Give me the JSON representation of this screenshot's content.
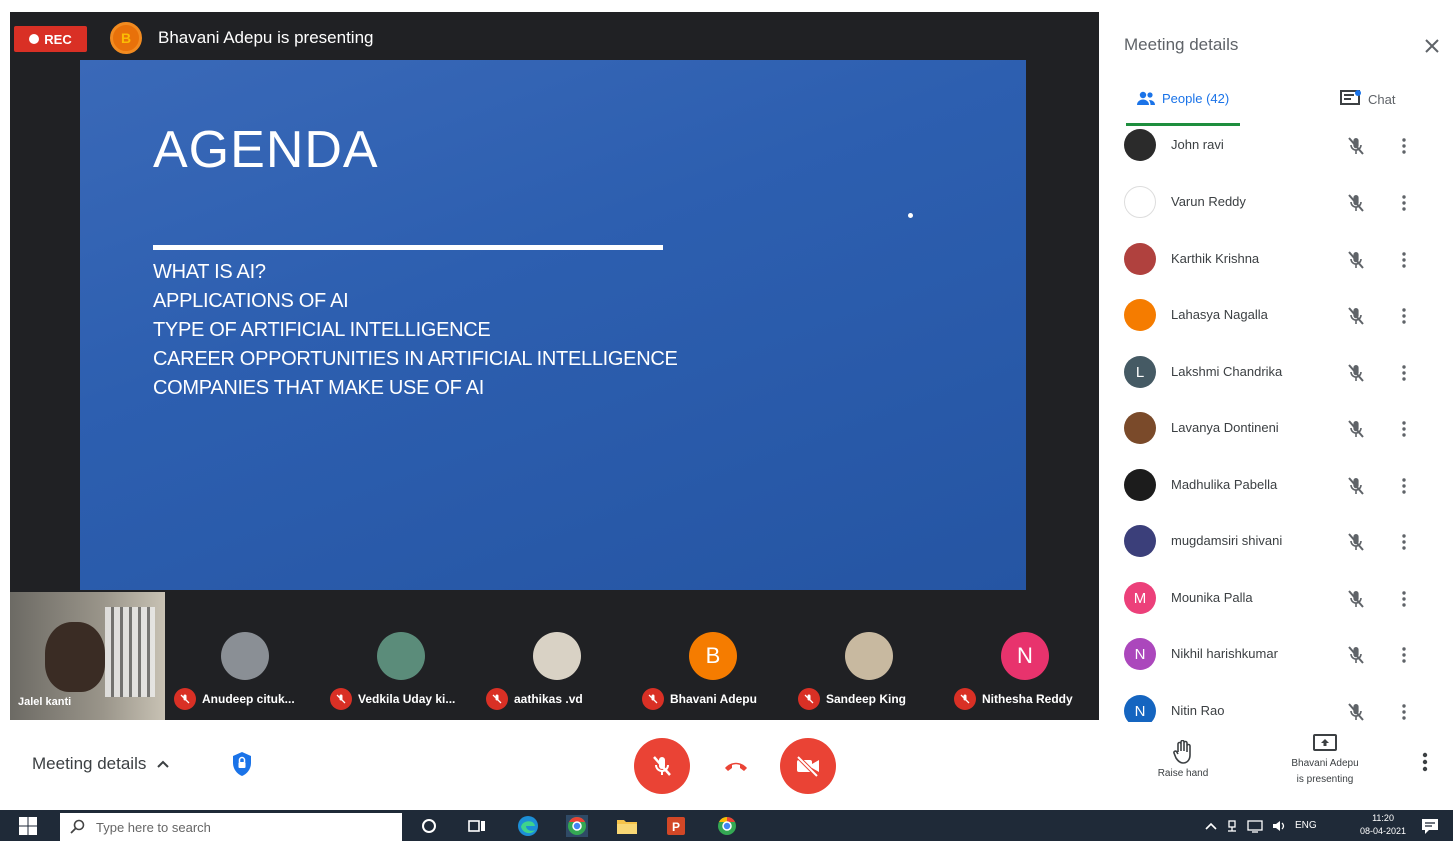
{
  "stage": {
    "rec_label": "REC",
    "presenter_initial": "B",
    "presenter_text": "Bhavani Adepu is presenting"
  },
  "slide": {
    "title": "AGENDA",
    "items": [
      "WHAT IS AI?",
      "APPLICATIONS OF AI",
      "TYPE OF ARTIFICIAL INTELLIGENCE",
      "CAREER OPPORTUNITIES IN ARTIFICIAL INTELLIGENCE",
      "COMPANIES THAT MAKE USE OF AI"
    ]
  },
  "filmstrip": {
    "self_name": "Jalel kanti",
    "tiles": [
      {
        "name": "Anudeep cituk...",
        "initial": "",
        "color": "#8a8f95"
      },
      {
        "name": "Vedkila Uday ki...",
        "initial": "",
        "color": "#5b8c7a"
      },
      {
        "name": "aathikas .vd",
        "initial": "",
        "color": "#d9d2c5"
      },
      {
        "name": "Bhavani Adepu",
        "initial": "B",
        "color": "#f57c00"
      },
      {
        "name": "Sandeep King",
        "initial": "",
        "color": "#c8b9a0"
      },
      {
        "name": "Nithesha Reddy",
        "initial": "N",
        "color": "#e8336d"
      }
    ]
  },
  "panel": {
    "title": "Meeting details",
    "tab_people": "People (42)",
    "tab_chat": "Chat",
    "people": [
      {
        "name": "John ravi",
        "initial": "",
        "color": "#2b2b2b"
      },
      {
        "name": "Varun Reddy",
        "initial": "",
        "color": "#ffffff"
      },
      {
        "name": "Karthik Krishna",
        "initial": "",
        "color": "#b0413e"
      },
      {
        "name": "Lahasya Nagalla",
        "initial": "",
        "color": "#f57c00"
      },
      {
        "name": "Lakshmi Chandrika",
        "initial": "L",
        "color": "#455a64"
      },
      {
        "name": "Lavanya Dontineni",
        "initial": "",
        "color": "#7a4a2a"
      },
      {
        "name": "Madhulika Pabella",
        "initial": "",
        "color": "#1c1c1c"
      },
      {
        "name": "mugdamsiri shivani",
        "initial": "",
        "color": "#3b3f7a"
      },
      {
        "name": "Mounika Palla",
        "initial": "M",
        "color": "#ec407a"
      },
      {
        "name": "Nikhil harishkumar",
        "initial": "N",
        "color": "#ab47bc"
      },
      {
        "name": "Nitin Rao",
        "initial": "N",
        "color": "#1565c0"
      }
    ]
  },
  "controls": {
    "meeting_details": "Meeting details",
    "raise_hand": "Raise hand",
    "present_line1": "Bhavani Adepu",
    "present_line2": "is presenting"
  },
  "taskbar": {
    "search_placeholder": "Type here to search",
    "tray_lang": "ENG",
    "clock_time": "11:20",
    "clock_date": "08-04-2021"
  }
}
